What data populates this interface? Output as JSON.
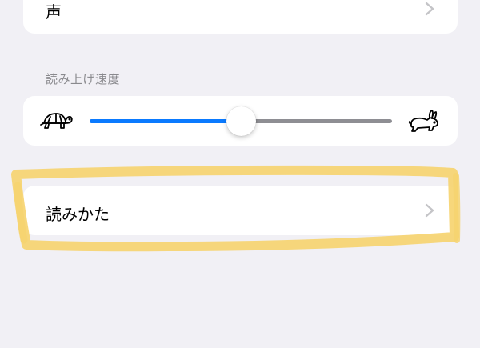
{
  "voice_row": {
    "label": "声"
  },
  "speech_rate": {
    "header": "読み上げ速度",
    "slow_icon": "turtle-icon",
    "fast_icon": "rabbit-icon",
    "value": 0.5
  },
  "pronunciation_row": {
    "label": "読みかた"
  },
  "colors": {
    "background": "#f1f0f5",
    "accent": "#0a7aff",
    "highlight": "#f6d470"
  }
}
